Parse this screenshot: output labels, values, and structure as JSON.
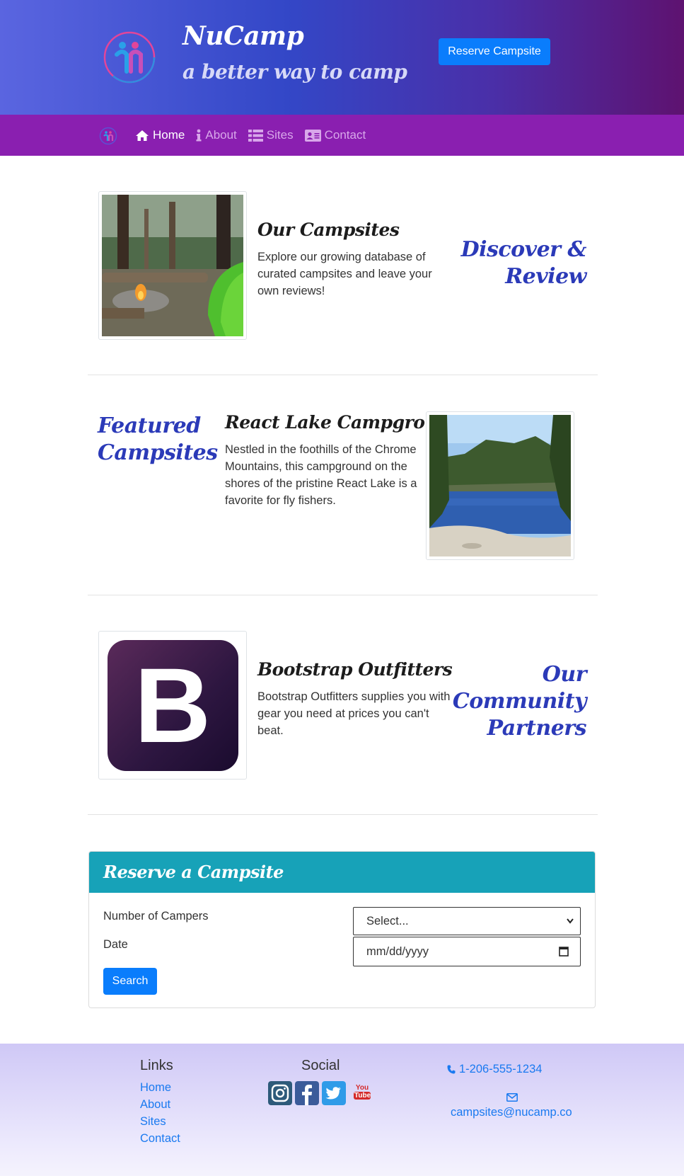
{
  "header": {
    "brand": "NuCamp",
    "tagline": "a better way to camp",
    "reserve_button": "Reserve Campsite"
  },
  "nav": {
    "items": [
      {
        "label": "Home",
        "icon": "home-icon",
        "active": true
      },
      {
        "label": "About",
        "icon": "info-icon",
        "active": false
      },
      {
        "label": "Sites",
        "icon": "list-icon",
        "active": false
      },
      {
        "label": "Contact",
        "icon": "address-card-icon",
        "active": false
      }
    ]
  },
  "sections": {
    "campsites": {
      "title": "Our Campsites",
      "text": [
        "Explore our growing database of",
        "curated campsites and leave your",
        "own reviews!"
      ],
      "side_heading": [
        "Discover &",
        "Review"
      ]
    },
    "featured": {
      "side_heading": [
        "Featured",
        "Campsites"
      ],
      "title": "React Lake Campground",
      "text": [
        "Nestled in the foothills of the Chrome",
        "Mountains, this campground on the",
        "shores of the pristine React Lake is a",
        "favorite for fly fishers."
      ]
    },
    "partners": {
      "title": "Bootstrap Outfitters",
      "text": [
        "Bootstrap Outfitters supplies you with",
        "gear you need at prices you can't",
        "beat."
      ],
      "side_heading": [
        "Our",
        "Community",
        "Partners"
      ],
      "logo_letter": "B"
    }
  },
  "reservation": {
    "title": "Reserve a Campsite",
    "campers_label": "Number of Campers",
    "campers_value": "Select...",
    "date_label": "Date",
    "date_placeholder": "mm/dd/yyyy",
    "search_button": "Search"
  },
  "footer": {
    "links_heading": "Links",
    "links": [
      "Home",
      "About",
      "Sites",
      "Contact"
    ],
    "social_heading": "Social",
    "social_icons": [
      "instagram-icon",
      "facebook-icon",
      "twitter-icon",
      "youtube-icon"
    ],
    "youtube_text": [
      "You",
      "Tube"
    ],
    "phone": "1-206-555-1234",
    "email": "campsites@nucamp.co"
  },
  "colors": {
    "accent_blue": "#0a7dfc",
    "heading_blue": "#2b3ab8",
    "navbar_purple": "#8a1fb0",
    "card_teal": "#17a2b8",
    "link_blue": "#1a7af0"
  }
}
